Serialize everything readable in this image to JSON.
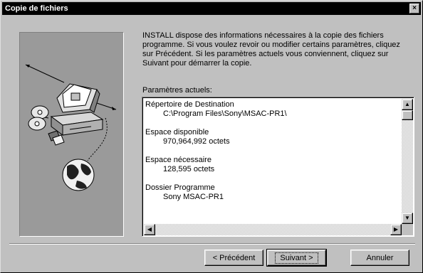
{
  "window": {
    "title": "Copie de fichiers",
    "close_glyph": "×"
  },
  "intro_text": "INSTALL dispose des informations nécessaires à la copie des fichiers programme. Si vous voulez revoir ou modifier certains paramètres, cliquez sur Précédent. Si les paramètres actuels vous conviennent, cliquez sur Suivant pour démarrer la copie.",
  "params_label": "Paramètres actuels:",
  "settings": [
    {
      "label": "Répertoire de Destination",
      "value": "C:\\Program Files\\Sony\\MSAC-PR1\\"
    },
    {
      "label": "Espace disponible",
      "value": "970,964,992 octets"
    },
    {
      "label": "Espace nécessaire",
      "value": "128,595 octets"
    },
    {
      "label": "Dossier Programme",
      "value": "Sony MSAC-PR1"
    }
  ],
  "buttons": {
    "back": "< Précédent",
    "next": "Suivant >",
    "cancel": "Annuler"
  },
  "icons": {
    "close": "close-icon",
    "scroll_up": "arrow-up-icon",
    "scroll_down": "arrow-down-icon",
    "scroll_left": "arrow-left-icon",
    "scroll_right": "arrow-right-icon",
    "illustration": "computer-install-illustration"
  }
}
